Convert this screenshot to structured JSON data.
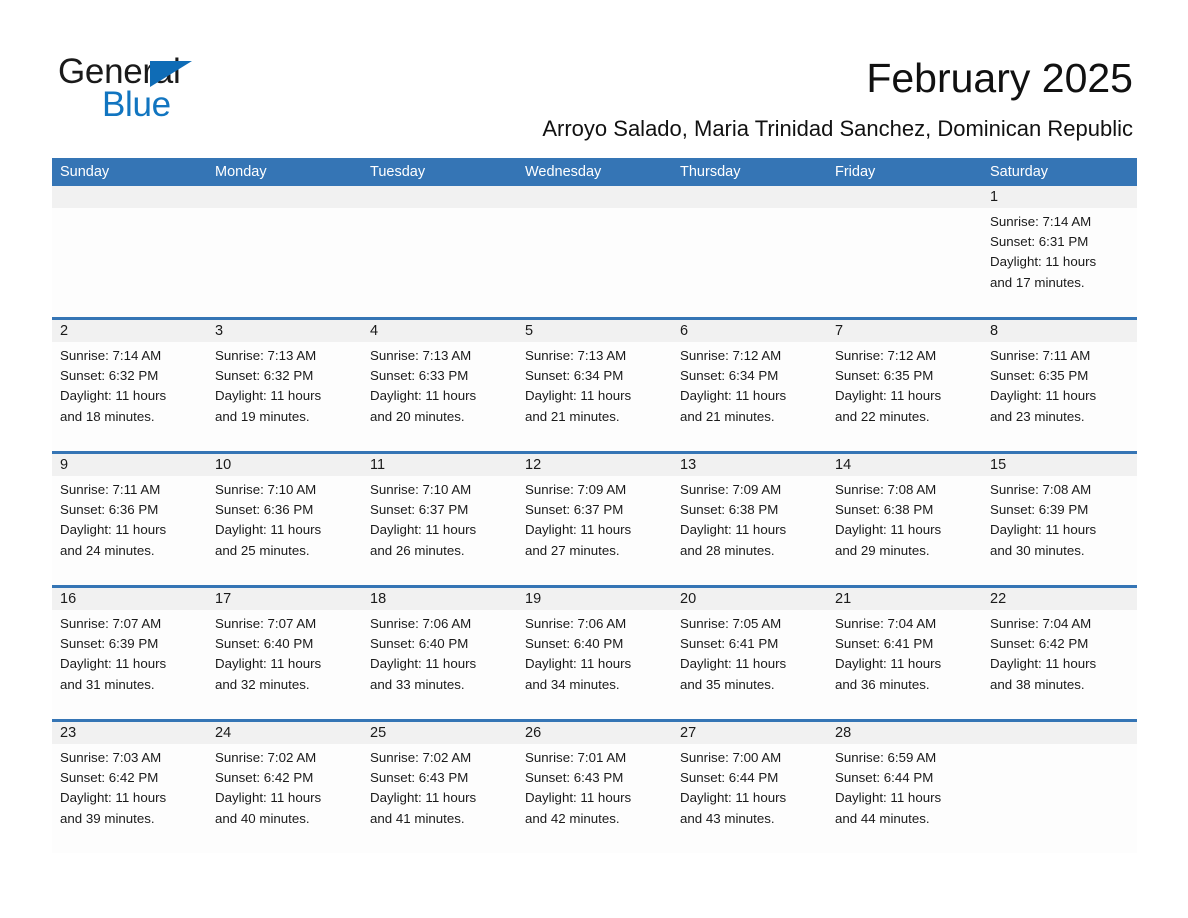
{
  "brand": {
    "line1": "General",
    "line2": "Blue",
    "accent_color": "#1175c0"
  },
  "header": {
    "title": "February 2025",
    "subtitle": "Arroyo Salado, Maria Trinidad Sanchez, Dominican Republic"
  },
  "calendar": {
    "header_color": "#3575b5",
    "weekdays": [
      "Sunday",
      "Monday",
      "Tuesday",
      "Wednesday",
      "Thursday",
      "Friday",
      "Saturday"
    ],
    "weeks": [
      [
        {
          "day": "",
          "sunrise": "",
          "sunset": "",
          "daylight1": "",
          "daylight2": "",
          "empty": true
        },
        {
          "day": "",
          "sunrise": "",
          "sunset": "",
          "daylight1": "",
          "daylight2": "",
          "empty": true
        },
        {
          "day": "",
          "sunrise": "",
          "sunset": "",
          "daylight1": "",
          "daylight2": "",
          "empty": true
        },
        {
          "day": "",
          "sunrise": "",
          "sunset": "",
          "daylight1": "",
          "daylight2": "",
          "empty": true
        },
        {
          "day": "",
          "sunrise": "",
          "sunset": "",
          "daylight1": "",
          "daylight2": "",
          "empty": true
        },
        {
          "day": "",
          "sunrise": "",
          "sunset": "",
          "daylight1": "",
          "daylight2": "",
          "empty": true
        },
        {
          "day": "1",
          "sunrise": "Sunrise: 7:14 AM",
          "sunset": "Sunset: 6:31 PM",
          "daylight1": "Daylight: 11 hours",
          "daylight2": "and 17 minutes.",
          "empty": false
        }
      ],
      [
        {
          "day": "2",
          "sunrise": "Sunrise: 7:14 AM",
          "sunset": "Sunset: 6:32 PM",
          "daylight1": "Daylight: 11 hours",
          "daylight2": "and 18 minutes.",
          "empty": false
        },
        {
          "day": "3",
          "sunrise": "Sunrise: 7:13 AM",
          "sunset": "Sunset: 6:32 PM",
          "daylight1": "Daylight: 11 hours",
          "daylight2": "and 19 minutes.",
          "empty": false
        },
        {
          "day": "4",
          "sunrise": "Sunrise: 7:13 AM",
          "sunset": "Sunset: 6:33 PM",
          "daylight1": "Daylight: 11 hours",
          "daylight2": "and 20 minutes.",
          "empty": false
        },
        {
          "day": "5",
          "sunrise": "Sunrise: 7:13 AM",
          "sunset": "Sunset: 6:34 PM",
          "daylight1": "Daylight: 11 hours",
          "daylight2": "and 21 minutes.",
          "empty": false
        },
        {
          "day": "6",
          "sunrise": "Sunrise: 7:12 AM",
          "sunset": "Sunset: 6:34 PM",
          "daylight1": "Daylight: 11 hours",
          "daylight2": "and 21 minutes.",
          "empty": false
        },
        {
          "day": "7",
          "sunrise": "Sunrise: 7:12 AM",
          "sunset": "Sunset: 6:35 PM",
          "daylight1": "Daylight: 11 hours",
          "daylight2": "and 22 minutes.",
          "empty": false
        },
        {
          "day": "8",
          "sunrise": "Sunrise: 7:11 AM",
          "sunset": "Sunset: 6:35 PM",
          "daylight1": "Daylight: 11 hours",
          "daylight2": "and 23 minutes.",
          "empty": false
        }
      ],
      [
        {
          "day": "9",
          "sunrise": "Sunrise: 7:11 AM",
          "sunset": "Sunset: 6:36 PM",
          "daylight1": "Daylight: 11 hours",
          "daylight2": "and 24 minutes.",
          "empty": false
        },
        {
          "day": "10",
          "sunrise": "Sunrise: 7:10 AM",
          "sunset": "Sunset: 6:36 PM",
          "daylight1": "Daylight: 11 hours",
          "daylight2": "and 25 minutes.",
          "empty": false
        },
        {
          "day": "11",
          "sunrise": "Sunrise: 7:10 AM",
          "sunset": "Sunset: 6:37 PM",
          "daylight1": "Daylight: 11 hours",
          "daylight2": "and 26 minutes.",
          "empty": false
        },
        {
          "day": "12",
          "sunrise": "Sunrise: 7:09 AM",
          "sunset": "Sunset: 6:37 PM",
          "daylight1": "Daylight: 11 hours",
          "daylight2": "and 27 minutes.",
          "empty": false
        },
        {
          "day": "13",
          "sunrise": "Sunrise: 7:09 AM",
          "sunset": "Sunset: 6:38 PM",
          "daylight1": "Daylight: 11 hours",
          "daylight2": "and 28 minutes.",
          "empty": false
        },
        {
          "day": "14",
          "sunrise": "Sunrise: 7:08 AM",
          "sunset": "Sunset: 6:38 PM",
          "daylight1": "Daylight: 11 hours",
          "daylight2": "and 29 minutes.",
          "empty": false
        },
        {
          "day": "15",
          "sunrise": "Sunrise: 7:08 AM",
          "sunset": "Sunset: 6:39 PM",
          "daylight1": "Daylight: 11 hours",
          "daylight2": "and 30 minutes.",
          "empty": false
        }
      ],
      [
        {
          "day": "16",
          "sunrise": "Sunrise: 7:07 AM",
          "sunset": "Sunset: 6:39 PM",
          "daylight1": "Daylight: 11 hours",
          "daylight2": "and 31 minutes.",
          "empty": false
        },
        {
          "day": "17",
          "sunrise": "Sunrise: 7:07 AM",
          "sunset": "Sunset: 6:40 PM",
          "daylight1": "Daylight: 11 hours",
          "daylight2": "and 32 minutes.",
          "empty": false
        },
        {
          "day": "18",
          "sunrise": "Sunrise: 7:06 AM",
          "sunset": "Sunset: 6:40 PM",
          "daylight1": "Daylight: 11 hours",
          "daylight2": "and 33 minutes.",
          "empty": false
        },
        {
          "day": "19",
          "sunrise": "Sunrise: 7:06 AM",
          "sunset": "Sunset: 6:40 PM",
          "daylight1": "Daylight: 11 hours",
          "daylight2": "and 34 minutes.",
          "empty": false
        },
        {
          "day": "20",
          "sunrise": "Sunrise: 7:05 AM",
          "sunset": "Sunset: 6:41 PM",
          "daylight1": "Daylight: 11 hours",
          "daylight2": "and 35 minutes.",
          "empty": false
        },
        {
          "day": "21",
          "sunrise": "Sunrise: 7:04 AM",
          "sunset": "Sunset: 6:41 PM",
          "daylight1": "Daylight: 11 hours",
          "daylight2": "and 36 minutes.",
          "empty": false
        },
        {
          "day": "22",
          "sunrise": "Sunrise: 7:04 AM",
          "sunset": "Sunset: 6:42 PM",
          "daylight1": "Daylight: 11 hours",
          "daylight2": "and 38 minutes.",
          "empty": false
        }
      ],
      [
        {
          "day": "23",
          "sunrise": "Sunrise: 7:03 AM",
          "sunset": "Sunset: 6:42 PM",
          "daylight1": "Daylight: 11 hours",
          "daylight2": "and 39 minutes.",
          "empty": false
        },
        {
          "day": "24",
          "sunrise": "Sunrise: 7:02 AM",
          "sunset": "Sunset: 6:42 PM",
          "daylight1": "Daylight: 11 hours",
          "daylight2": "and 40 minutes.",
          "empty": false
        },
        {
          "day": "25",
          "sunrise": "Sunrise: 7:02 AM",
          "sunset": "Sunset: 6:43 PM",
          "daylight1": "Daylight: 11 hours",
          "daylight2": "and 41 minutes.",
          "empty": false
        },
        {
          "day": "26",
          "sunrise": "Sunrise: 7:01 AM",
          "sunset": "Sunset: 6:43 PM",
          "daylight1": "Daylight: 11 hours",
          "daylight2": "and 42 minutes.",
          "empty": false
        },
        {
          "day": "27",
          "sunrise": "Sunrise: 7:00 AM",
          "sunset": "Sunset: 6:44 PM",
          "daylight1": "Daylight: 11 hours",
          "daylight2": "and 43 minutes.",
          "empty": false
        },
        {
          "day": "28",
          "sunrise": "Sunrise: 6:59 AM",
          "sunset": "Sunset: 6:44 PM",
          "daylight1": "Daylight: 11 hours",
          "daylight2": "and 44 minutes.",
          "empty": false
        },
        {
          "day": "",
          "sunrise": "",
          "sunset": "",
          "daylight1": "",
          "daylight2": "",
          "empty": true
        }
      ]
    ]
  }
}
